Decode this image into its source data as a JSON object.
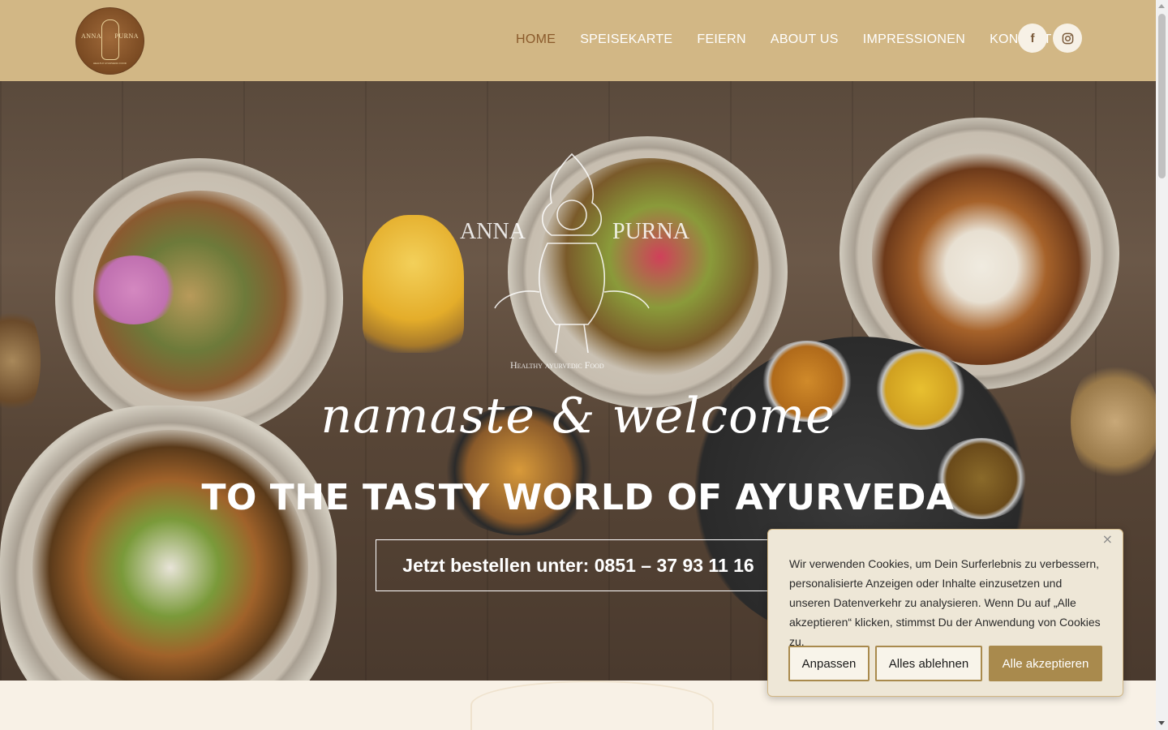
{
  "logo": {
    "left_text": "ANNA",
    "right_text": "PURNA",
    "subtitle": "HEALTHY AYURVEDIC FOOD"
  },
  "nav": {
    "items": [
      {
        "label": "HOME",
        "active": true
      },
      {
        "label": "SPEISEKARTE",
        "active": false
      },
      {
        "label": "FEIERN",
        "active": false
      },
      {
        "label": "ABOUT US",
        "active": false
      },
      {
        "label": "IMPRESSIONEN",
        "active": false
      },
      {
        "label": "KONTAKT",
        "active": false
      }
    ]
  },
  "social": {
    "facebook": "f",
    "instagram_icon": "instagram-icon",
    "facebook_icon": "facebook-icon"
  },
  "hero": {
    "emblem_left": "ANNA",
    "emblem_right": "PURNA",
    "emblem_sub": "Healthy ayurvedic Food",
    "script": "namaste & welcome",
    "title": "TO THE TASTY WORLD OF AYURVEDA",
    "order_button": "Jetzt bestellen unter: 0851 – 37 93 11 16"
  },
  "cookie": {
    "close": "×",
    "text": "Wir verwenden Cookies, um Dein Surferlebnis zu verbessern, personalisierte Anzeigen oder Inhalte einzusetzen und unseren Datenverkehr zu analysieren. Wenn Du auf „Alle akzeptieren“ klicken, stimmst Du der Anwendung von Cookies zu.",
    "customize": "Anpassen",
    "reject": "Alles ablehnen",
    "accept": "Alle akzeptieren"
  },
  "colors": {
    "header_bg": "#d2b785",
    "nav_active": "#8a5a2b",
    "accent": "#a98a4d",
    "cookie_bg": "#eee7d7"
  }
}
